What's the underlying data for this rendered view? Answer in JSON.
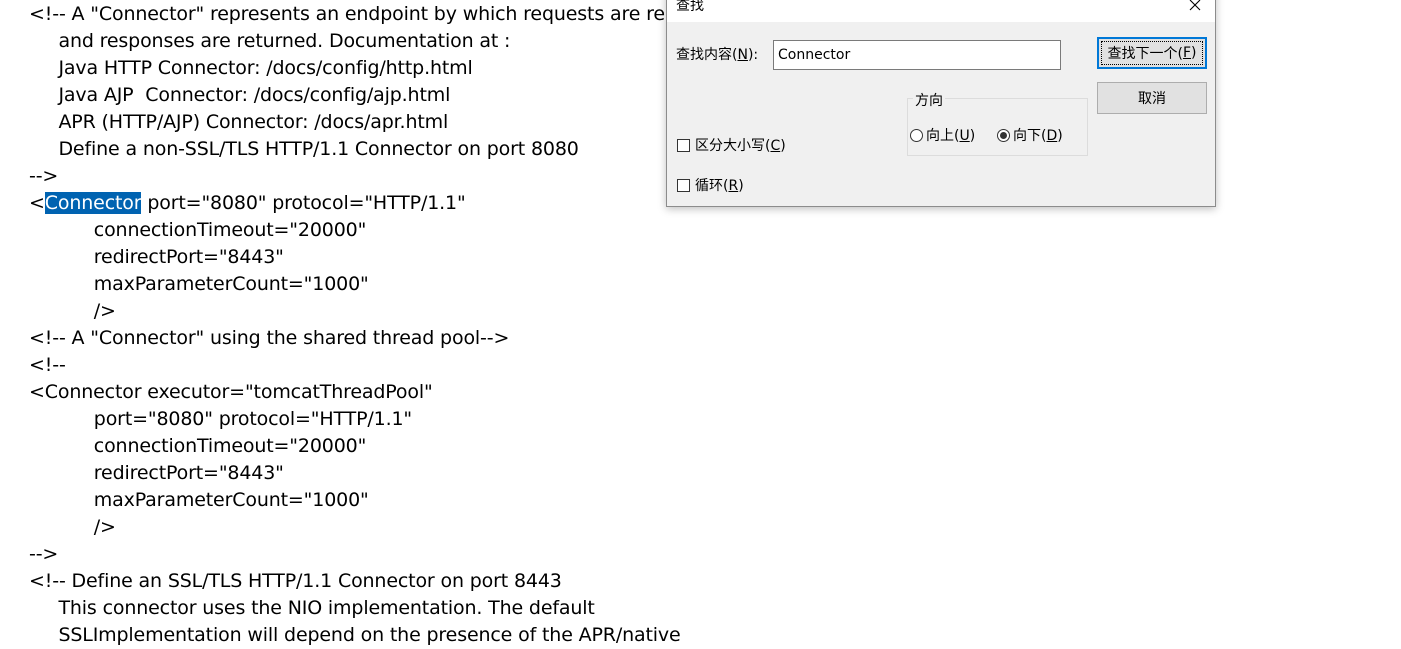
{
  "editor": {
    "lines": [
      "<!-- A \"Connector\" represents an endpoint by which requests are re",
      "     and responses are returned. Documentation at :",
      "     Java HTTP Connector: /docs/config/http.html",
      "     Java AJP  Connector: /docs/config/ajp.html",
      "     APR (HTTP/AJP) Connector: /docs/apr.html",
      "     Define a non-SSL/TLS HTTP/1.1 Connector on port 8080",
      "-->",
      "<Connector port=\"8080\" protocol=\"HTTP/1.1\"",
      "           connectionTimeout=\"20000\"",
      "           redirectPort=\"8443\"",
      "           maxParameterCount=\"1000\"",
      "           />",
      "<!-- A \"Connector\" using the shared thread pool-->",
      "<!--",
      "<Connector executor=\"tomcatThreadPool\"",
      "           port=\"8080\" protocol=\"HTTP/1.1\"",
      "           connectionTimeout=\"20000\"",
      "           redirectPort=\"8443\"",
      "           maxParameterCount=\"1000\"",
      "           />",
      "-->",
      "<!-- Define an SSL/TLS HTTP/1.1 Connector on port 8443",
      "     This connector uses the NIO implementation. The default",
      "     SSLImplementation will depend on the presence of the APR/native"
    ],
    "highlight_line": 7,
    "highlight_prefix": "<",
    "highlight_text": "Connector",
    "highlight_suffix": " port=\"8080\" protocol=\"HTTP/1.1\""
  },
  "dialog": {
    "title": "查找",
    "find_label": "查找内容(",
    "find_label_key": "N",
    "find_label_end": "):",
    "find_value": "Connector",
    "find_next_label": "查找下一个(",
    "find_next_key": "F",
    "find_next_end": ")",
    "cancel_label": "取消",
    "direction_label": "方向",
    "up_label": "向上(",
    "up_key": "U",
    "up_end": ")",
    "down_label": "向下(",
    "down_key": "D",
    "down_end": ")",
    "direction_selected": "down",
    "match_case_label": "区分大小写(",
    "match_case_key": "C",
    "match_case_end": ")",
    "match_case_checked": false,
    "wrap_label": "循环(",
    "wrap_key": "R",
    "wrap_end": ")",
    "wrap_checked": false
  },
  "colors": {
    "selection": "#0063b1",
    "dialog_bg": "#f0f0f0",
    "default_button_border": "#0078d7"
  },
  "icons": {
    "close": "close-icon"
  }
}
